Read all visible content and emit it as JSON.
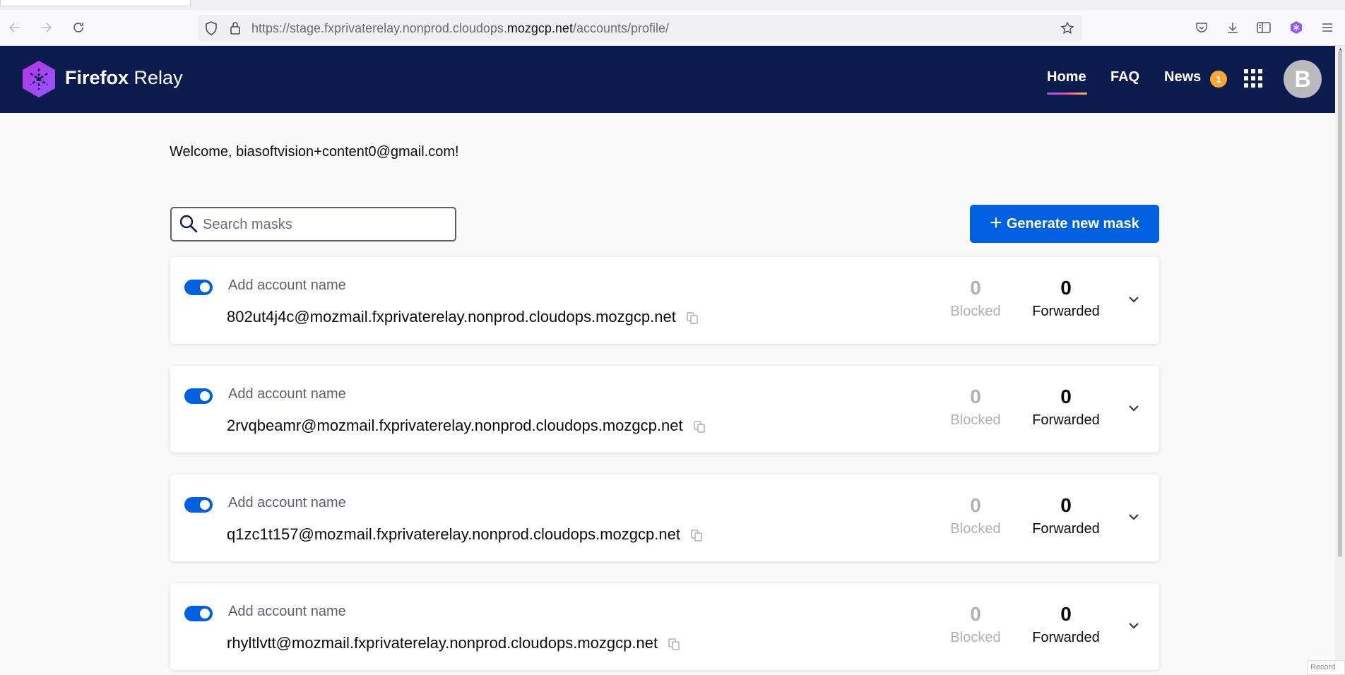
{
  "browser": {
    "url_prefix": "https://stage.fxprivaterelay.nonprod.cloudops.",
    "url_domain": "mozgcp.net",
    "url_path": "/accounts/profile/"
  },
  "header": {
    "brand_first": "Firefox",
    "brand_second": "Relay",
    "nav": {
      "home": "Home",
      "faq": "FAQ",
      "news": "News",
      "news_badge": "1"
    },
    "avatar_letter": "B"
  },
  "welcome": "Welcome, biasoftvision+content0@gmail.com!",
  "search": {
    "placeholder": "Search masks"
  },
  "generate_button": {
    "plus": "+",
    "label": "Generate new mask"
  },
  "masks": [
    {
      "name_placeholder": "Add account name",
      "email": "802ut4j4c@mozmail.fxprivaterelay.nonprod.cloudops.mozgcp.net",
      "blocked": "0",
      "blocked_label": "Blocked",
      "forwarded": "0",
      "forwarded_label": "Forwarded",
      "enabled": true
    },
    {
      "name_placeholder": "Add account name",
      "email": "2rvqbeamr@mozmail.fxprivaterelay.nonprod.cloudops.mozgcp.net",
      "blocked": "0",
      "blocked_label": "Blocked",
      "forwarded": "0",
      "forwarded_label": "Forwarded",
      "enabled": true
    },
    {
      "name_placeholder": "Add account name",
      "email": "q1zc1t157@mozmail.fxprivaterelay.nonprod.cloudops.mozgcp.net",
      "blocked": "0",
      "blocked_label": "Blocked",
      "forwarded": "0",
      "forwarded_label": "Forwarded",
      "enabled": true
    },
    {
      "name_placeholder": "Add account name",
      "email": "rhyltlvtt@mozmail.fxprivaterelay.nonprod.cloudops.mozgcp.net",
      "blocked": "0",
      "blocked_label": "Blocked",
      "forwarded": "0",
      "forwarded_label": "Forwarded",
      "enabled": true
    }
  ],
  "record_label": "Record",
  "colors": {
    "header_bg": "#0c1c4e",
    "primary_blue": "#0060df",
    "badge_orange": "#f8a830",
    "logo_purple": "#9059ff"
  }
}
